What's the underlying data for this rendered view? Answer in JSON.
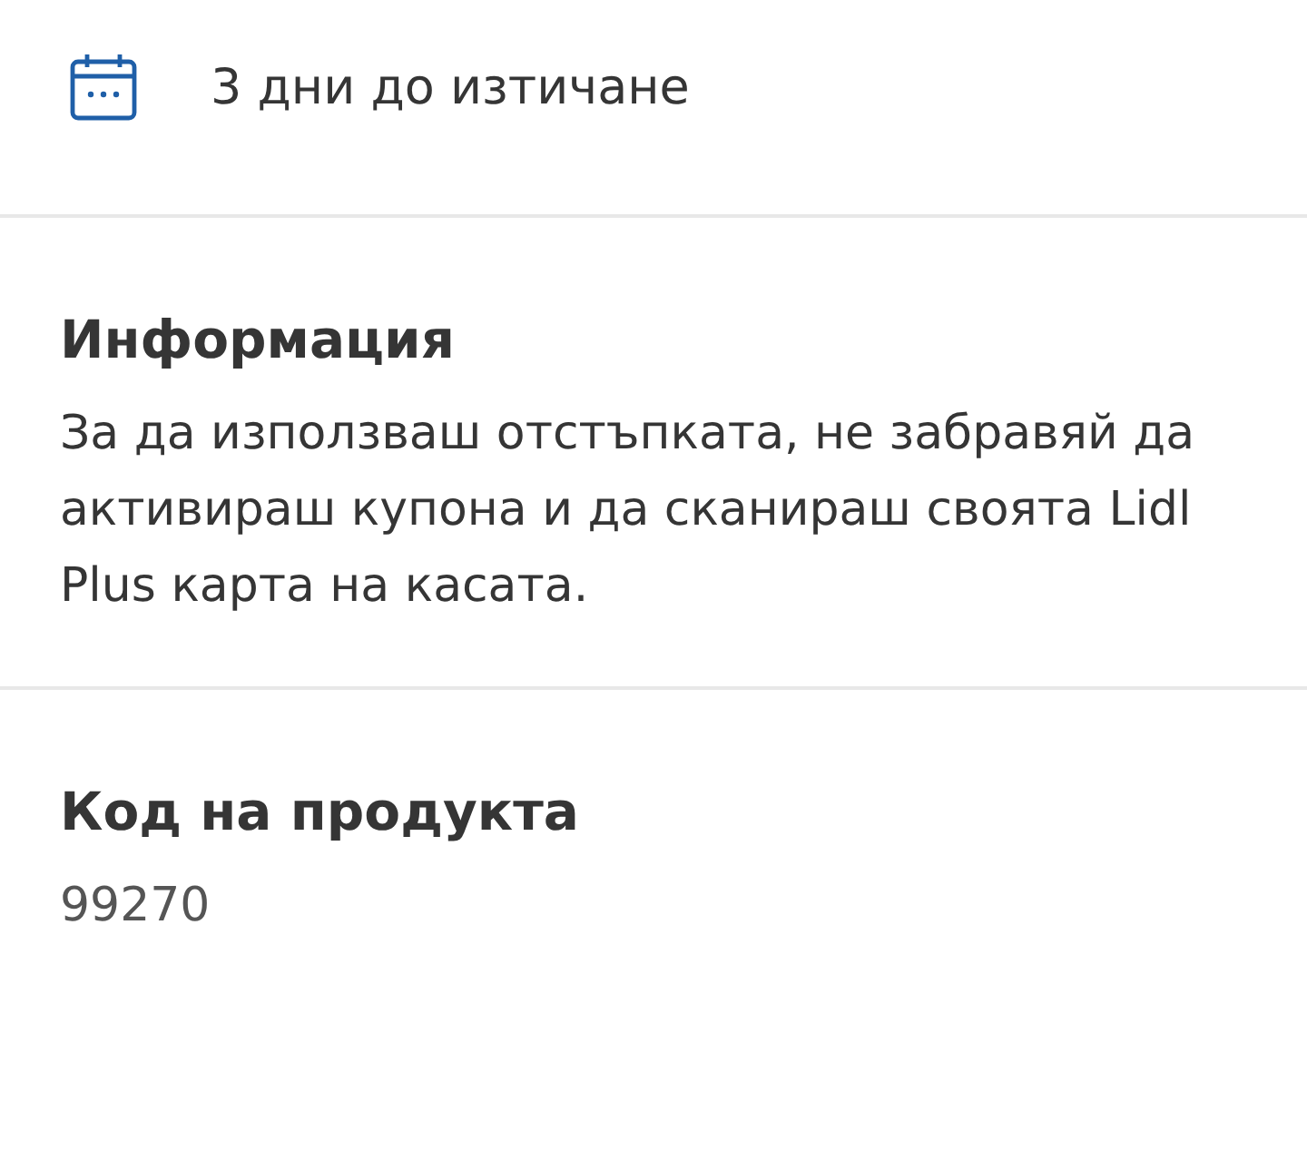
{
  "expiry": {
    "text": "3 дни до изтичане"
  },
  "sections": [
    {
      "title": "Информация",
      "body": "За да използваш отстъпката, не забравяй да активираш купона и да сканираш своята Lidl Plus карта на касата."
    },
    {
      "title": "Код на продукта",
      "body": "99270"
    }
  ]
}
